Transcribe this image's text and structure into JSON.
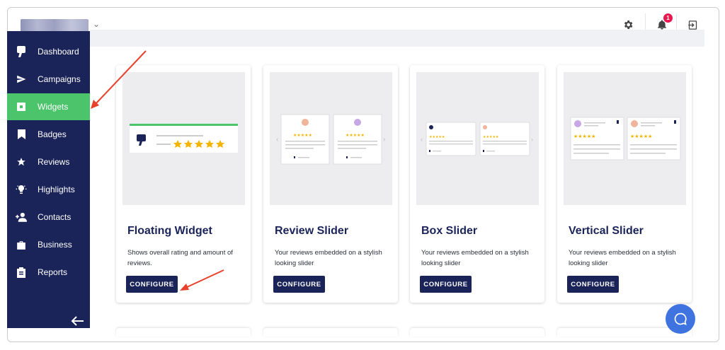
{
  "sidebar": {
    "items": [
      {
        "label": "Dashboard",
        "icon": "brand-logo-icon"
      },
      {
        "label": "Campaigns",
        "icon": "send-icon"
      },
      {
        "label": "Widgets",
        "icon": "widget-icon",
        "active": true
      },
      {
        "label": "Badges",
        "icon": "bookmark-icon"
      },
      {
        "label": "Reviews",
        "icon": "star-icon"
      },
      {
        "label": "Highlights",
        "icon": "lightbulb-icon"
      },
      {
        "label": "Contacts",
        "icon": "add-person-icon"
      },
      {
        "label": "Business",
        "icon": "briefcase-icon"
      },
      {
        "label": "Reports",
        "icon": "clipboard-icon"
      }
    ]
  },
  "header": {
    "notification_count": "1"
  },
  "cards": [
    {
      "title": "Floating Widget",
      "description": "Shows overall rating and amount of reviews.",
      "button": "CONFIGURE"
    },
    {
      "title": "Review Slider",
      "description": "Your reviews embedded on a stylish looking slider",
      "button": "CONFIGURE"
    },
    {
      "title": "Box Slider",
      "description": "Your reviews embedded on a stylish looking slider",
      "button": "CONFIGURE"
    },
    {
      "title": "Vertical Slider",
      "description": "Your reviews embedded on a stylish looking slider",
      "button": "CONFIGURE"
    }
  ],
  "colors": {
    "sidebar_bg": "#1b2459",
    "active_green": "#4cc46b",
    "accent_blue": "#3f73e0",
    "star_yellow": "#f5b400",
    "annotation_red": "#e8412c"
  }
}
